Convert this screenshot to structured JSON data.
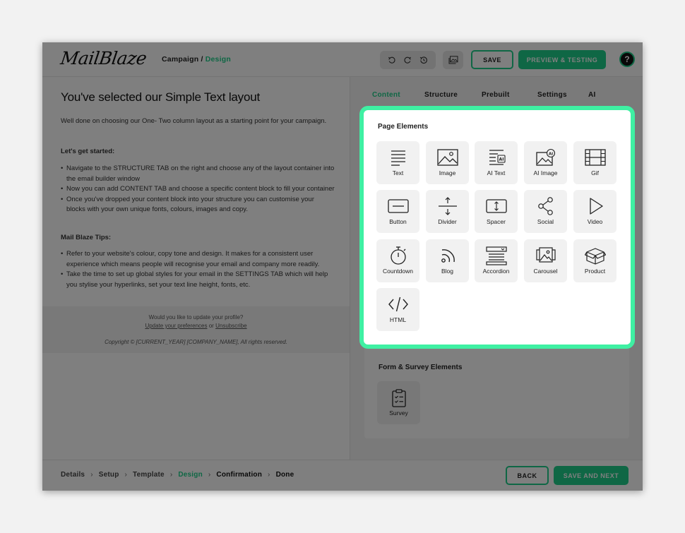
{
  "header": {
    "logo": "MailBlaze",
    "breadcrumb_root": "Campaign",
    "breadcrumb_sep": "/",
    "breadcrumb_current": "Design",
    "save_label": "SAVE",
    "preview_label": "PREVIEW & TESTING",
    "help_label": "?"
  },
  "left": {
    "title": "You've selected our Simple Text layout",
    "intro": "Well done on choosing our One- Two column layout as a starting point for your campaign.",
    "get_started_heading": "Let's get started:",
    "get_started_items": [
      "Navigate to the STRUCTURE TAB on the right and choose any of the layout container into the email builder window",
      "Now you can add CONTENT TAB and choose a specific content block to fill your container",
      "Once you've dropped your content block into your structure you can customise your blocks with your own unique fonts, colours, images and copy."
    ],
    "tips_heading": "Mail Blaze Tips:",
    "tips_items": [
      "Refer to your website's colour, copy tone and design. It makes for a consistent user experience which means people will recognise your email and company more readily.",
      "Take the time to set up global styles for your email in the SETTINGS TAB which will help you stylise your hyperlinks, set your text line height, fonts, etc."
    ],
    "footer": {
      "question": "Would you like to update your profile?",
      "update_link": "Update your preferences",
      "or": "or",
      "unsubscribe_link": "Unsubscribe",
      "copyright": "Copyright © [CURRENT_YEAR] [COMPANY_NAME], All rights reserved."
    }
  },
  "right": {
    "tabs": [
      "Content",
      "Structure",
      "Prebuilt",
      "Settings",
      "AI"
    ],
    "active_tab": "Content",
    "page_elements_title": "Page Elements",
    "page_elements": [
      {
        "label": "Text",
        "icon": "text-icon"
      },
      {
        "label": "Image",
        "icon": "image-icon"
      },
      {
        "label": "AI Text",
        "icon": "ai-text-icon"
      },
      {
        "label": "AI Image",
        "icon": "ai-image-icon"
      },
      {
        "label": "Gif",
        "icon": "film-icon"
      },
      {
        "label": "Button",
        "icon": "button-icon"
      },
      {
        "label": "Divider",
        "icon": "divider-icon"
      },
      {
        "label": "Spacer",
        "icon": "spacer-icon"
      },
      {
        "label": "Social",
        "icon": "share-icon"
      },
      {
        "label": "Video",
        "icon": "play-icon"
      },
      {
        "label": "Countdown",
        "icon": "stopwatch-icon"
      },
      {
        "label": "Blog",
        "icon": "rss-icon"
      },
      {
        "label": "Accordion",
        "icon": "accordion-icon"
      },
      {
        "label": "Carousel",
        "icon": "carousel-icon"
      },
      {
        "label": "Product",
        "icon": "box-icon"
      },
      {
        "label": "HTML",
        "icon": "code-icon"
      }
    ],
    "form_title": "Form & Survey Elements",
    "form_elements": [
      {
        "label": "Survey",
        "icon": "clipboard-icon"
      }
    ]
  },
  "bottom": {
    "steps": [
      "Details",
      "Setup",
      "Template",
      "Design",
      "Confirmation",
      "Done"
    ],
    "current_step": "Design",
    "back_label": "BACK",
    "next_label": "SAVE AND NEXT"
  },
  "colors": {
    "accent": "#1fcf8a",
    "highlight_border": "#3ff0a3"
  }
}
